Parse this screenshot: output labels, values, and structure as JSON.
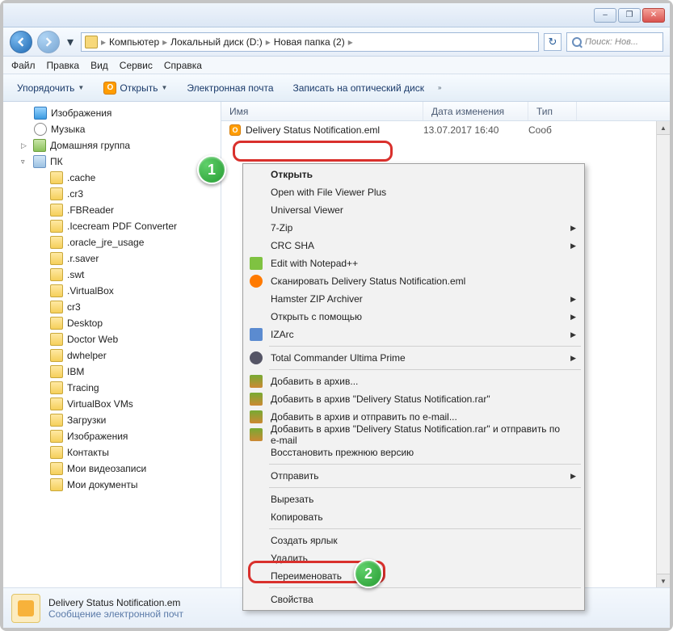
{
  "window": {
    "min": "–",
    "max": "❐",
    "close": "✕"
  },
  "breadcrumb": {
    "root": "Компьютер",
    "disk": "Локальный диск (D:)",
    "folder": "Новая папка (2)"
  },
  "search": {
    "placeholder": "Поиск: Нов..."
  },
  "menubar": [
    "Файл",
    "Правка",
    "Вид",
    "Сервис",
    "Справка"
  ],
  "toolbar": {
    "organize": "Упорядочить",
    "open": "Открыть",
    "email": "Электронная почта",
    "burn": "Записать на оптический диск"
  },
  "tree": {
    "images": "Изображения",
    "music": "Музыка",
    "homegroup": "Домашняя группа",
    "pc": "ПК",
    "folders": [
      ".cache",
      ".cr3",
      ".FBReader",
      ".Icecream PDF Converter",
      ".oracle_jre_usage",
      ".r.saver",
      ".swt",
      ".VirtualBox",
      "cr3",
      "Desktop",
      "Doctor Web",
      "dwhelper",
      "IBM",
      "Tracing",
      "VirtualBox VMs",
      "Загрузки",
      "Изображения",
      "Контакты",
      "Мои видеозаписи",
      "Мои документы"
    ]
  },
  "columns": {
    "name": "Имя",
    "date": "Дата изменения",
    "type": "Тип"
  },
  "files": {
    "selected": {
      "name": "Delivery Status Notification.eml",
      "date": "13.07.2017 16:40",
      "type": "Сооб"
    }
  },
  "context": {
    "open": "Открыть",
    "openfvp": "Open with File Viewer Plus",
    "uviewer": "Universal Viewer",
    "7zip": "7-Zip",
    "crcsha": "CRC SHA",
    "notepadpp": "Edit with Notepad++",
    "scan": "Сканировать Delivery Status Notification.eml",
    "hamster": "Hamster ZIP Archiver",
    "openwith": "Открыть с помощью",
    "izarc": "IZArc",
    "tcup": "Total Commander Ultima Prime",
    "addarch": "Добавить в архив...",
    "addrar": "Добавить в архив \"Delivery Status Notification.rar\"",
    "addemail": "Добавить в архив и отправить по e-mail...",
    "addraremail": "Добавить в архив \"Delivery Status Notification.rar\" и отправить по e-mail",
    "restore": "Восстановить прежнюю версию",
    "send": "Отправить",
    "cut": "Вырезать",
    "copy": "Копировать",
    "shortcut": "Создать ярлык",
    "delete": "Удалить",
    "rename": "Переименовать",
    "props": "Свойства"
  },
  "status": {
    "filename": "Delivery Status Notification.em",
    "desc": "Сообщение электронной почт"
  },
  "badges": {
    "one": "1",
    "two": "2"
  }
}
